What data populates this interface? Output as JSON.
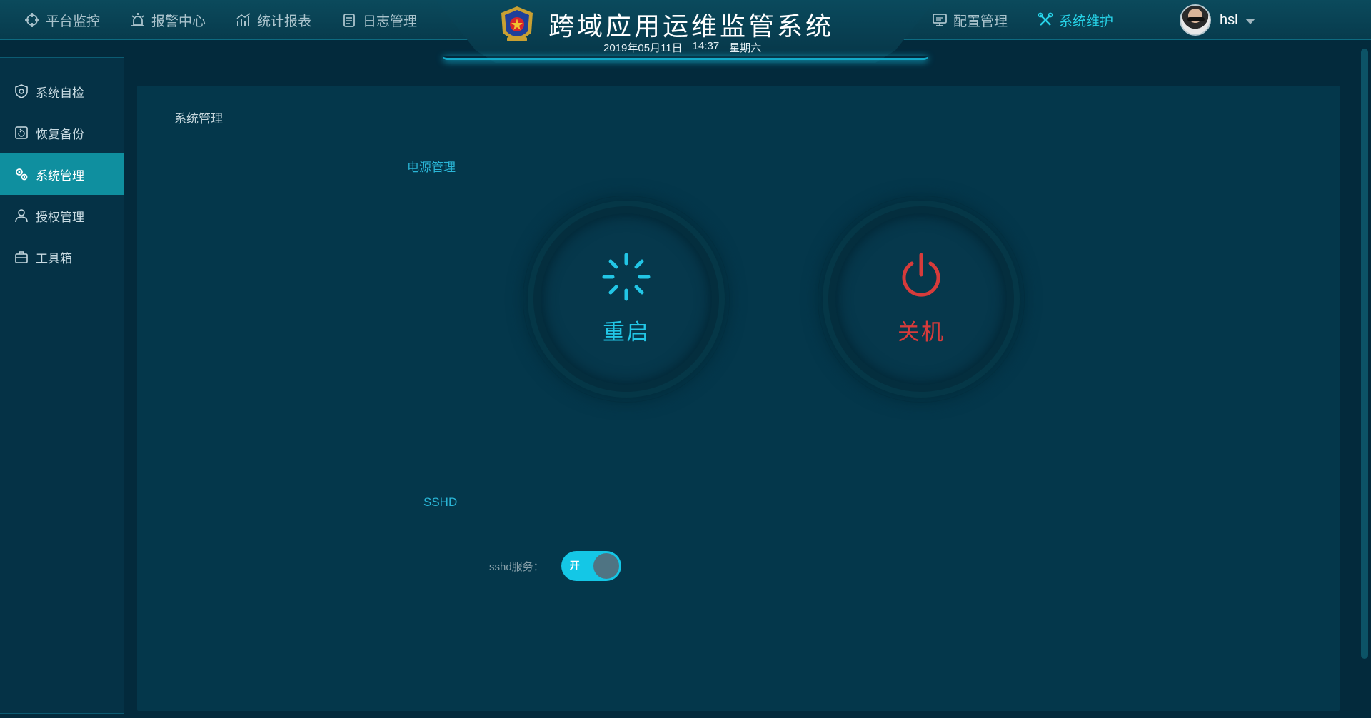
{
  "header": {
    "title": "跨域应用运维监管系统",
    "date": "2019年05月11日",
    "time": "14:37",
    "weekday": "星期六",
    "nav_left": [
      {
        "label": "平台监控",
        "icon": "crosshair-icon"
      },
      {
        "label": "报警中心",
        "icon": "alarm-light-icon"
      },
      {
        "label": "统计报表",
        "icon": "chart-icon"
      },
      {
        "label": "日志管理",
        "icon": "log-icon"
      }
    ],
    "nav_right": [
      {
        "label": "配置管理",
        "icon": "monitor-icon"
      },
      {
        "label": "系统维护",
        "icon": "tools-icon",
        "active": true
      }
    ],
    "user": {
      "name": "hsl"
    }
  },
  "sidebar": {
    "items": [
      {
        "label": "系统自检",
        "icon": "shield-icon"
      },
      {
        "label": "恢复备份",
        "icon": "backup-icon"
      },
      {
        "label": "系统管理",
        "icon": "gears-icon",
        "active": true
      },
      {
        "label": "授权管理",
        "icon": "user-icon"
      },
      {
        "label": "工具箱",
        "icon": "toolbox-icon"
      }
    ]
  },
  "main": {
    "breadcrumb": "系统管理",
    "power_section": "电源管理",
    "restart_label": "重启",
    "shutdown_label": "关机",
    "sshd_section": "SSHD",
    "sshd_label": "sshd服务：",
    "sshd_toggle": {
      "text": "开",
      "state": "on"
    }
  },
  "colors": {
    "accent": "#27d3e8",
    "restart": "#22c6e6",
    "shutdown": "#d63b3b",
    "sidebar_active": "#0f8f9f",
    "background": "#032a3c"
  }
}
